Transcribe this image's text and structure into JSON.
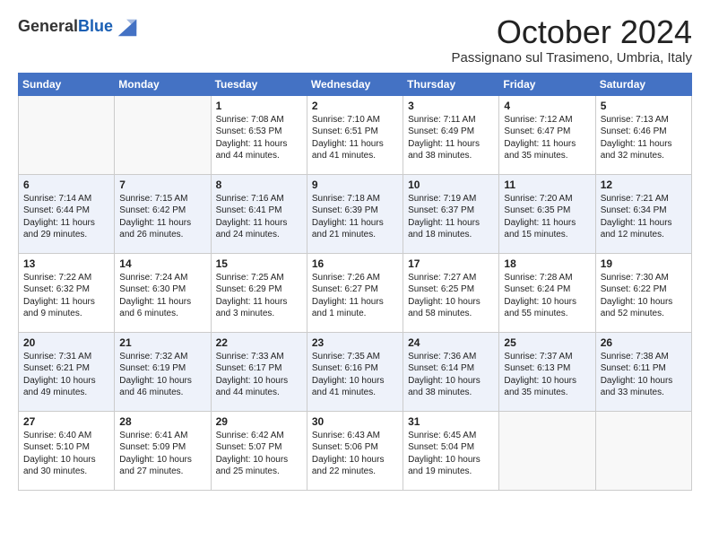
{
  "logo": {
    "general": "General",
    "blue": "Blue"
  },
  "header": {
    "month": "October 2024",
    "location": "Passignano sul Trasimeno, Umbria, Italy"
  },
  "weekdays": [
    "Sunday",
    "Monday",
    "Tuesday",
    "Wednesday",
    "Thursday",
    "Friday",
    "Saturday"
  ],
  "weeks": [
    [
      {
        "day": "",
        "info": ""
      },
      {
        "day": "",
        "info": ""
      },
      {
        "day": "1",
        "info": "Sunrise: 7:08 AM\nSunset: 6:53 PM\nDaylight: 11 hours and 44 minutes."
      },
      {
        "day": "2",
        "info": "Sunrise: 7:10 AM\nSunset: 6:51 PM\nDaylight: 11 hours and 41 minutes."
      },
      {
        "day": "3",
        "info": "Sunrise: 7:11 AM\nSunset: 6:49 PM\nDaylight: 11 hours and 38 minutes."
      },
      {
        "day": "4",
        "info": "Sunrise: 7:12 AM\nSunset: 6:47 PM\nDaylight: 11 hours and 35 minutes."
      },
      {
        "day": "5",
        "info": "Sunrise: 7:13 AM\nSunset: 6:46 PM\nDaylight: 11 hours and 32 minutes."
      }
    ],
    [
      {
        "day": "6",
        "info": "Sunrise: 7:14 AM\nSunset: 6:44 PM\nDaylight: 11 hours and 29 minutes."
      },
      {
        "day": "7",
        "info": "Sunrise: 7:15 AM\nSunset: 6:42 PM\nDaylight: 11 hours and 26 minutes."
      },
      {
        "day": "8",
        "info": "Sunrise: 7:16 AM\nSunset: 6:41 PM\nDaylight: 11 hours and 24 minutes."
      },
      {
        "day": "9",
        "info": "Sunrise: 7:18 AM\nSunset: 6:39 PM\nDaylight: 11 hours and 21 minutes."
      },
      {
        "day": "10",
        "info": "Sunrise: 7:19 AM\nSunset: 6:37 PM\nDaylight: 11 hours and 18 minutes."
      },
      {
        "day": "11",
        "info": "Sunrise: 7:20 AM\nSunset: 6:35 PM\nDaylight: 11 hours and 15 minutes."
      },
      {
        "day": "12",
        "info": "Sunrise: 7:21 AM\nSunset: 6:34 PM\nDaylight: 11 hours and 12 minutes."
      }
    ],
    [
      {
        "day": "13",
        "info": "Sunrise: 7:22 AM\nSunset: 6:32 PM\nDaylight: 11 hours and 9 minutes."
      },
      {
        "day": "14",
        "info": "Sunrise: 7:24 AM\nSunset: 6:30 PM\nDaylight: 11 hours and 6 minutes."
      },
      {
        "day": "15",
        "info": "Sunrise: 7:25 AM\nSunset: 6:29 PM\nDaylight: 11 hours and 3 minutes."
      },
      {
        "day": "16",
        "info": "Sunrise: 7:26 AM\nSunset: 6:27 PM\nDaylight: 11 hours and 1 minute."
      },
      {
        "day": "17",
        "info": "Sunrise: 7:27 AM\nSunset: 6:25 PM\nDaylight: 10 hours and 58 minutes."
      },
      {
        "day": "18",
        "info": "Sunrise: 7:28 AM\nSunset: 6:24 PM\nDaylight: 10 hours and 55 minutes."
      },
      {
        "day": "19",
        "info": "Sunrise: 7:30 AM\nSunset: 6:22 PM\nDaylight: 10 hours and 52 minutes."
      }
    ],
    [
      {
        "day": "20",
        "info": "Sunrise: 7:31 AM\nSunset: 6:21 PM\nDaylight: 10 hours and 49 minutes."
      },
      {
        "day": "21",
        "info": "Sunrise: 7:32 AM\nSunset: 6:19 PM\nDaylight: 10 hours and 46 minutes."
      },
      {
        "day": "22",
        "info": "Sunrise: 7:33 AM\nSunset: 6:17 PM\nDaylight: 10 hours and 44 minutes."
      },
      {
        "day": "23",
        "info": "Sunrise: 7:35 AM\nSunset: 6:16 PM\nDaylight: 10 hours and 41 minutes."
      },
      {
        "day": "24",
        "info": "Sunrise: 7:36 AM\nSunset: 6:14 PM\nDaylight: 10 hours and 38 minutes."
      },
      {
        "day": "25",
        "info": "Sunrise: 7:37 AM\nSunset: 6:13 PM\nDaylight: 10 hours and 35 minutes."
      },
      {
        "day": "26",
        "info": "Sunrise: 7:38 AM\nSunset: 6:11 PM\nDaylight: 10 hours and 33 minutes."
      }
    ],
    [
      {
        "day": "27",
        "info": "Sunrise: 6:40 AM\nSunset: 5:10 PM\nDaylight: 10 hours and 30 minutes."
      },
      {
        "day": "28",
        "info": "Sunrise: 6:41 AM\nSunset: 5:09 PM\nDaylight: 10 hours and 27 minutes."
      },
      {
        "day": "29",
        "info": "Sunrise: 6:42 AM\nSunset: 5:07 PM\nDaylight: 10 hours and 25 minutes."
      },
      {
        "day": "30",
        "info": "Sunrise: 6:43 AM\nSunset: 5:06 PM\nDaylight: 10 hours and 22 minutes."
      },
      {
        "day": "31",
        "info": "Sunrise: 6:45 AM\nSunset: 5:04 PM\nDaylight: 10 hours and 19 minutes."
      },
      {
        "day": "",
        "info": ""
      },
      {
        "day": "",
        "info": ""
      }
    ]
  ]
}
